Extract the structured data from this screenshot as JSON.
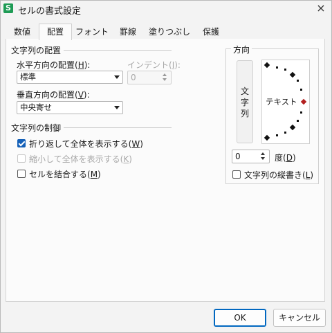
{
  "window": {
    "icon_letter": "S",
    "title": "セルの書式設定",
    "close_glyph": "×"
  },
  "tabs": [
    {
      "label": "数値",
      "active": false
    },
    {
      "label": "配置",
      "active": true
    },
    {
      "label": "フォント",
      "active": false
    },
    {
      "label": "罫線",
      "active": false
    },
    {
      "label": "塗りつぶし",
      "active": false
    },
    {
      "label": "保護",
      "active": false
    }
  ],
  "alignment": {
    "group_label": "文字列の配置",
    "horizontal": {
      "label": "水平方向の配置(",
      "key": "H",
      "label_end": "):",
      "value": "標準"
    },
    "indent": {
      "label": "インデント(",
      "key": "I",
      "label_end": "):",
      "value": "0",
      "disabled": true
    },
    "vertical": {
      "label": "垂直方向の配置(",
      "key": "V",
      "label_end": "):",
      "value": "中央寄せ"
    }
  },
  "text_control": {
    "group_label": "文字列の制御",
    "wrap": {
      "label": "折り返して全体を表示する(",
      "key": "W",
      "label_end": ")",
      "checked": true
    },
    "shrink": {
      "label": "縮小して全体を表示する(",
      "key": "K",
      "label_end": ")",
      "checked": false,
      "disabled": true
    },
    "merge": {
      "label": "セルを結合する(",
      "key": "M",
      "label_end": ")",
      "checked": false
    }
  },
  "orientation": {
    "group_label": "方向",
    "vertical_text": [
      "文",
      "字",
      "列"
    ],
    "dial_text": "テキスト",
    "degrees_value": "0",
    "degrees_label": "度(",
    "degrees_key": "D",
    "degrees_label_end": ")",
    "vertical_layout": {
      "label": "文字列の縦書き(",
      "key": "L",
      "label_end": ")",
      "checked": false
    }
  },
  "buttons": {
    "ok": "OK",
    "cancel": "キャンセル"
  },
  "colors": {
    "accent": "#1460b8",
    "ok_border": "#0067c0",
    "dial_marker": "#b32020"
  }
}
